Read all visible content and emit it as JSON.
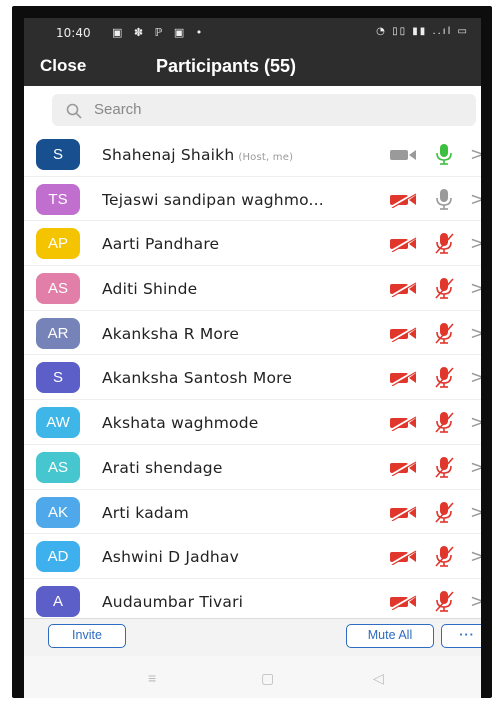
{
  "status_bar": {
    "time": "10:40"
  },
  "header": {
    "close_label": "Close",
    "title": "Participants (55)"
  },
  "search": {
    "placeholder": "Search",
    "icon": "search-icon"
  },
  "colors": {
    "accent": "#2d6cc0",
    "muted_red": "#e0362c",
    "unmuted_green": "#3fbf3f",
    "gray": "#9a9a9a"
  },
  "participants": [
    {
      "initials": "S",
      "name": "Shahenaj Shaikh",
      "tag": "(Host, me)",
      "color": "#174f8f",
      "video": "on",
      "mic": "on"
    },
    {
      "initials": "TS",
      "name": "Tejaswi sandipan waghmo...",
      "tag": "",
      "color": "#c06fcf",
      "video": "off",
      "mic": "gray"
    },
    {
      "initials": "AP",
      "name": "Aarti Pandhare",
      "tag": "",
      "color": "#f5c400",
      "video": "off",
      "mic": "muted"
    },
    {
      "initials": "AS",
      "name": "Aditi Shinde",
      "tag": "",
      "color": "#e27fa8",
      "video": "off",
      "mic": "muted"
    },
    {
      "initials": "AR",
      "name": "Akanksha R More",
      "tag": "",
      "color": "#7583b8",
      "video": "off",
      "mic": "muted"
    },
    {
      "initials": "S",
      "name": "Akanksha Santosh  More",
      "tag": "",
      "color": "#5b5fc7",
      "video": "off",
      "mic": "muted"
    },
    {
      "initials": "AW",
      "name": "Akshata waghmode",
      "tag": "",
      "color": "#3fb6e8",
      "video": "off",
      "mic": "muted"
    },
    {
      "initials": "AS",
      "name": "Arati shendage",
      "tag": "",
      "color": "#46c6cf",
      "video": "off",
      "mic": "muted"
    },
    {
      "initials": "AK",
      "name": "Arti kadam",
      "tag": "",
      "color": "#4fa8ea",
      "video": "off",
      "mic": "muted"
    },
    {
      "initials": "AD",
      "name": "Ashwini D Jadhav",
      "tag": "",
      "color": "#3fb0ee",
      "video": "off",
      "mic": "muted"
    },
    {
      "initials": "A",
      "name": "Audaumbar Tivari",
      "tag": "",
      "color": "#5b5fc7",
      "video": "off",
      "mic": "muted"
    }
  ],
  "footer": {
    "invite_label": "Invite",
    "mute_all_label": "Mute All",
    "more_label": "···"
  },
  "nav": {
    "menu_icon": "≡",
    "home_icon": "▢",
    "back_icon": "◁"
  }
}
